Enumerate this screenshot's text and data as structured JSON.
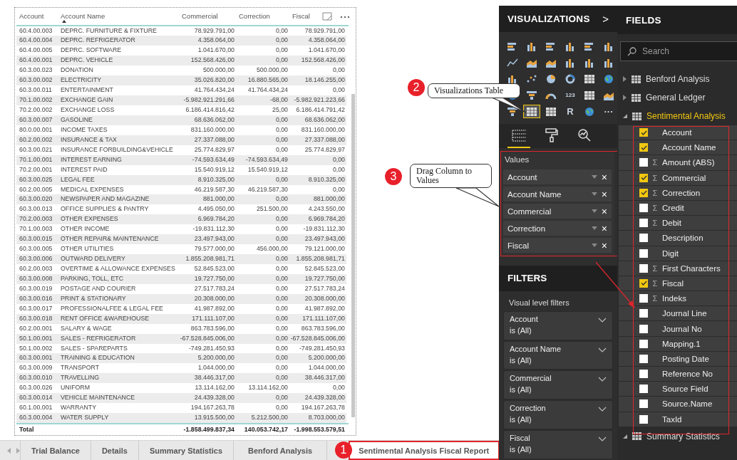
{
  "table_visual": {
    "columns": [
      {
        "label": "Account",
        "sorted": false
      },
      {
        "label": "Account Name",
        "sorted": true
      },
      {
        "label": "Commercial",
        "sorted": false
      },
      {
        "label": "Correction",
        "sorted": false
      },
      {
        "label": "Fiscal",
        "sorted": false
      }
    ],
    "rows": [
      [
        "60.4.00.003",
        "DEPRC. FURNITURE & FIXTURE",
        "78.929.791,00",
        "0,00",
        "78.929.791,00"
      ],
      [
        "60.4.00.004",
        "DEPRC. REFRIGERATOR",
        "4.358.064,00",
        "0,00",
        "4.358.064,00"
      ],
      [
        "60.4.00.005",
        "DEPRC. SOFTWARE",
        "1.041.670,00",
        "0,00",
        "1.041.670,00"
      ],
      [
        "60.4.00.001",
        "DEPRC. VEHICLE",
        "152.568.426,00",
        "0,00",
        "152.568.426,00"
      ],
      [
        "60.3.00.023",
        "DONATION",
        "500.000,00",
        "500.000,00",
        "0,00"
      ],
      [
        "60.3.00.002",
        "ELECTRICITY",
        "35.026.820,00",
        "16.880.565,00",
        "18.146.255,00"
      ],
      [
        "60.3.00.011",
        "ENTERTAINMENT",
        "41.764.434,24",
        "41.764.434,24",
        "0,00"
      ],
      [
        "70.1.00.002",
        "EXCHANGE GAIN",
        "-5.982.921.291,66",
        "-68,00",
        "-5.982.921.223,66"
      ],
      [
        "70.2.00.002",
        "EXCHANGE LOSS",
        "6.186.414.816,42",
        "25,00",
        "6.186.414.791,42"
      ],
      [
        "60.3.00.007",
        "GASOLINE",
        "68.636.062,00",
        "0,00",
        "68.636.062,00"
      ],
      [
        "80.0.00.001",
        "INCOME TAXES",
        "831.160.000,00",
        "0,00",
        "831.160.000,00"
      ],
      [
        "60.2.00.002",
        "INSURANCE & TAX",
        "27.337.088,00",
        "0,00",
        "27.337.088,00"
      ],
      [
        "60.3.00.021",
        "INSURANCE FORBUILDING&VEHICLE",
        "25.774.829,97",
        "0,00",
        "25.774.829,97"
      ],
      [
        "70.1.00.001",
        "INTEREST EARNING",
        "-74.593.634,49",
        "-74.593.634,49",
        "0,00"
      ],
      [
        "70.2.00.001",
        "INTEREST PAID",
        "15.540.919,12",
        "15.540.919,12",
        "0,00"
      ],
      [
        "60.3.00.025",
        "LEGAL FEE",
        "8.910.325,00",
        "0,00",
        "8.910.325,00"
      ],
      [
        "60.2.00.005",
        "MEDICAL EXPENSES",
        "46.219.587,30",
        "46.219.587,30",
        "0,00"
      ],
      [
        "60.3.00.020",
        "NEWSPAPER AND MAGAZINE",
        "881.000,00",
        "0,00",
        "881.000,00"
      ],
      [
        "60.3.00.013",
        "OFFICE SUPPLIES & PANTRY",
        "4.495.050,00",
        "251.500,00",
        "4.243.550,00"
      ],
      [
        "70.2.00.003",
        "OTHER EXPENSES",
        "6.969.784,20",
        "0,00",
        "6.969.784,20"
      ],
      [
        "70.1.00.003",
        "OTHER INCOME",
        "-19.831.112,30",
        "0,00",
        "-19.831.112,30"
      ],
      [
        "60.3.00.015",
        "OTHER REPAIR& MAINTENANCE",
        "23.497.943,00",
        "0,00",
        "23.497.943,00"
      ],
      [
        "60.3.00.005",
        "OTHER UTILITIES",
        "79.577.000,00",
        "456.000,00",
        "79.121.000,00"
      ],
      [
        "60.3.00.006",
        "OUTWARD DELIVERY",
        "1.855.208.981,71",
        "0,00",
        "1.855.208.981,71"
      ],
      [
        "60.2.00.003",
        "OVERTIME & ALLOWANCE EXPENSES",
        "52.845.523,00",
        "0,00",
        "52.845.523,00"
      ],
      [
        "60.3.00.008",
        "PARKING, TOLL, ETC",
        "19.727.750,00",
        "0,00",
        "19.727.750,00"
      ],
      [
        "60.3.00.019",
        "POSTAGE AND COURIER",
        "27.517.783,24",
        "0,00",
        "27.517.783,24"
      ],
      [
        "60.3.00.016",
        "PRINT & STATIONARY",
        "20.308.000,00",
        "0,00",
        "20.308.000,00"
      ],
      [
        "60.3.00.017",
        "PROFESSIONALFEE & LEGAL FEE",
        "41.987.892,00",
        "0,00",
        "41.987.892,00"
      ],
      [
        "60.3.00.018",
        "RENT OFFICE &WAREHOUSE",
        "171.111.107,00",
        "0,00",
        "171.111.107,00"
      ],
      [
        "60.2.00.001",
        "SALARY & WAGE",
        "863.783.596,00",
        "0,00",
        "863.783.596,00"
      ],
      [
        "50.1.00.001",
        "SALES - REFRIGERATOR",
        "-67.528.845.006,00",
        "0,00",
        "-67.528.845.006,00"
      ],
      [
        "50.1.00.002",
        "SALES - SPAREPARTS",
        "-749.281.450,93",
        "0,00",
        "-749.281.450,93"
      ],
      [
        "60.3.00.001",
        "TRAINING & EDUCATION",
        "5.200.000,00",
        "0,00",
        "5.200.000,00"
      ],
      [
        "60.3.00.009",
        "TRANSPORT",
        "1.044.000,00",
        "0,00",
        "1.044.000,00"
      ],
      [
        "60.3.00.010",
        "TRAVELLING",
        "38.446.317,00",
        "0,00",
        "38.446.317,00"
      ],
      [
        "60.3.00.026",
        "UNIFORM",
        "13.114.162,00",
        "13.114.162,00",
        "0,00"
      ],
      [
        "60.3.00.014",
        "VEHICLE MAINTENANCE",
        "24.439.328,00",
        "0,00",
        "24.439.328,00"
      ],
      [
        "60.1.00.001",
        "WARRANTY",
        "194.167.263,78",
        "0,00",
        "194.167.263,78"
      ],
      [
        "60.3.00.004",
        "WATER SUPPLY",
        "13.915.500,00",
        "5.212.500,00",
        "8.703.000,00"
      ]
    ],
    "total": {
      "label": "Total",
      "values": [
        "-1.858.499.837,34",
        "140.053.742,17",
        "-1.998.553.579,51"
      ]
    }
  },
  "page_tabs": [
    {
      "label": "Trial Balance",
      "selected": false
    },
    {
      "label": "Details",
      "selected": false
    },
    {
      "label": "Summary Statistics",
      "selected": false
    },
    {
      "label": "Benford Analysis",
      "selected": false
    },
    {
      "label": "Sentimental Analysis Fiscal Report",
      "selected": true
    }
  ],
  "visualizations": {
    "title": "VISUALIZATIONS",
    "collapse": ">",
    "icons": [
      {
        "kind": "hbar",
        "selected": false
      },
      {
        "kind": "col",
        "selected": false
      },
      {
        "kind": "hbar",
        "selected": false
      },
      {
        "kind": "col",
        "selected": false
      },
      {
        "kind": "hbar",
        "selected": false
      },
      {
        "kind": "col",
        "selected": false
      },
      {
        "kind": "line",
        "selected": false
      },
      {
        "kind": "area",
        "selected": false
      },
      {
        "kind": "area",
        "selected": false
      },
      {
        "kind": "col",
        "selected": false
      },
      {
        "kind": "col",
        "selected": false
      },
      {
        "kind": "col",
        "selected": false
      },
      {
        "kind": "col",
        "selected": false
      },
      {
        "kind": "scatter",
        "selected": false
      },
      {
        "kind": "pie",
        "selected": false
      },
      {
        "kind": "donut",
        "selected": false
      },
      {
        "kind": "grid",
        "selected": false
      },
      {
        "kind": "globe",
        "selected": false
      },
      {
        "kind": "globe",
        "selected": false
      },
      {
        "kind": "funnel",
        "selected": false
      },
      {
        "kind": "gauge",
        "selected": false
      },
      {
        "kind": "text",
        "label": "123",
        "selected": false
      },
      {
        "kind": "grid",
        "selected": false
      },
      {
        "kind": "area",
        "selected": false
      },
      {
        "kind": "funnel",
        "selected": false
      },
      {
        "kind": "grid",
        "selected": true
      },
      {
        "kind": "grid",
        "selected": false
      },
      {
        "kind": "text",
        "label": "R",
        "selected": false
      },
      {
        "kind": "globe",
        "selected": false
      },
      {
        "kind": "text",
        "label": "···",
        "selected": false
      }
    ],
    "panes": [
      {
        "kind": "fields",
        "selected": true
      },
      {
        "kind": "format",
        "selected": false
      },
      {
        "kind": "analytics",
        "selected": false
      }
    ],
    "values_label": "Values",
    "wells": [
      {
        "label": "Account",
        "remove": "×"
      },
      {
        "label": "Account Name",
        "remove": "×"
      },
      {
        "label": "Commercial",
        "remove": "×"
      },
      {
        "label": "Correction",
        "remove": "×"
      },
      {
        "label": "Fiscal",
        "remove": "×"
      }
    ],
    "filters_title": "FILTERS",
    "filters_subtitle": "Visual level filters",
    "filters": [
      {
        "field": "Account",
        "condition": "is (All)"
      },
      {
        "field": "Account Name",
        "condition": "is (All)"
      },
      {
        "field": "Commercial",
        "condition": "is (All)"
      },
      {
        "field": "Correction",
        "condition": "is (All)"
      },
      {
        "field": "Fiscal",
        "condition": "is (All)"
      }
    ]
  },
  "fields": {
    "title": "FIELDS",
    "search_placeholder": "Search",
    "tables": [
      {
        "name": "Benford Analysis",
        "expanded": false
      },
      {
        "name": "General Ledger",
        "expanded": false
      },
      {
        "name": "Sentimental Analysis",
        "expanded": true,
        "fields": [
          {
            "name": "Account",
            "checked": true
          },
          {
            "name": "Account Name",
            "checked": true
          },
          {
            "name": "Amount (ABS)",
            "checked": false,
            "icon": "Σ"
          },
          {
            "name": "Commercial",
            "checked": true,
            "icon": "Σ"
          },
          {
            "name": "Correction",
            "checked": true,
            "icon": "Σ"
          },
          {
            "name": "Credit",
            "checked": false,
            "icon": "Σ"
          },
          {
            "name": "Debit",
            "checked": false,
            "icon": "Σ"
          },
          {
            "name": "Description",
            "checked": false
          },
          {
            "name": "Digit",
            "checked": false
          },
          {
            "name": "First Characters",
            "checked": false,
            "icon": "Σ"
          },
          {
            "name": "Fiscal",
            "checked": true,
            "icon": "Σ"
          },
          {
            "name": "Indeks",
            "checked": false,
            "icon": "Σ"
          },
          {
            "name": "Journal Line",
            "checked": false
          },
          {
            "name": "Journal No",
            "checked": false
          },
          {
            "name": "Mapping.1",
            "checked": false
          },
          {
            "name": "Posting Date",
            "checked": false
          },
          {
            "name": "Reference No",
            "checked": false
          },
          {
            "name": "Source Field",
            "checked": false
          },
          {
            "name": "Source.Name",
            "checked": false
          },
          {
            "name": "TaxId",
            "checked": false
          }
        ]
      },
      {
        "name": "Summary Statistics",
        "expanded": true
      }
    ]
  },
  "callouts": [
    {
      "number": "1"
    },
    {
      "number": "2",
      "text": "Visualizations Table"
    },
    {
      "number": "3",
      "text": "Drag Column to Values"
    }
  ]
}
